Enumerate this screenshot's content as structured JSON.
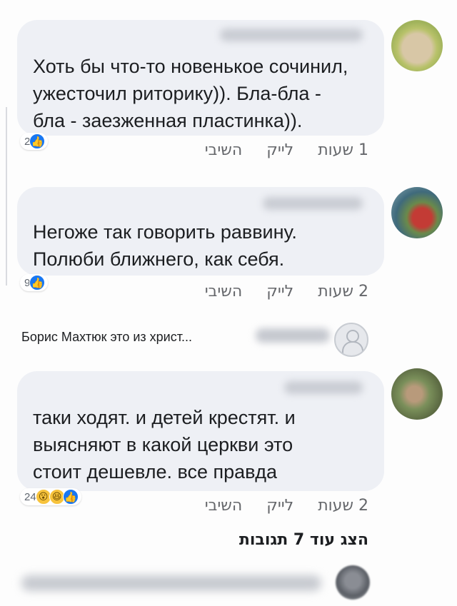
{
  "comments": [
    {
      "text": "Хоть бы что-то новенькое сочинил,\nужесточил  риторику)). Бла-бла -\nбла   - заезженная пластинка)).",
      "reaction_count": "2",
      "time": "1 שעות",
      "like_label": "לייק",
      "reply_label": "השיבי"
    },
    {
      "text": "Негоже так говорить раввину.\nПолюби ближнего, как себя.",
      "reaction_count": "9",
      "time": "2 שעות",
      "like_label": "לייק",
      "reply_label": "השיבי"
    },
    {
      "text": "таки ходят. и детей крестят. и\nвыясняют в какой церкви это\nстоит дешевле. все правда",
      "reaction_count": "24",
      "time": "2 שעות",
      "like_label": "לייק",
      "reply_label": "השיבי"
    }
  ],
  "collapsed_reply": {
    "text": "Борис Махтюк это из христ..."
  },
  "more_replies": "הצג עוד 7 תגובות",
  "icons": {
    "like": "like-reaction-icon",
    "wow": "wow-reaction-icon",
    "haha": "haha-reaction-icon",
    "avatar": "default-avatar-icon"
  },
  "colors": {
    "bubble": "#eef0f5",
    "like_blue": "#1877f2",
    "muted_text": "#65676b"
  }
}
